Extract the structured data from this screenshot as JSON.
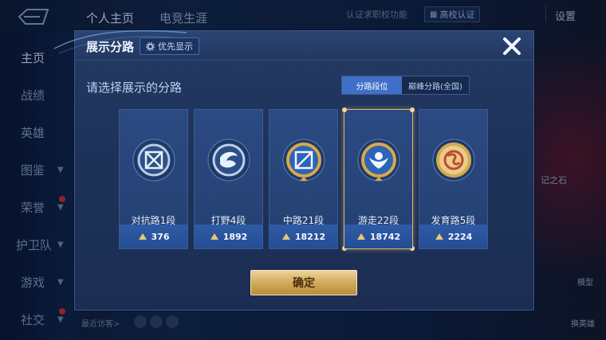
{
  "app": {
    "top_tabs": [
      "个人主页",
      "电竞生涯"
    ],
    "cert_link": "认证求职校功能",
    "cert_button": "高校认证",
    "settings": "设置",
    "nav": [
      {
        "label": "主页"
      },
      {
        "label": "战绩"
      },
      {
        "label": "英雄"
      },
      {
        "label": "图鉴"
      },
      {
        "label": "荣誉"
      },
      {
        "label": "护卫队"
      },
      {
        "label": "游戏"
      },
      {
        "label": "社交"
      }
    ],
    "recent_visitors": "最近访客>",
    "right_text": "记之石",
    "right_btn_model": "模型",
    "right_btn_swap": "换英雄"
  },
  "modal": {
    "title": "展示分路",
    "priority_button": "优先显示",
    "subtitle": "请选择展示的分路",
    "segments": {
      "active": "分路段位",
      "inactive": "巅峰分路(全国)"
    },
    "confirm": "确定",
    "cards": [
      {
        "label": "对抗路1段",
        "score": "376",
        "icon": "clash-lane-emblem",
        "emblem_color": "#b8cce6",
        "selected": false
      },
      {
        "label": "打野4段",
        "score": "1892",
        "icon": "jungle-emblem",
        "emblem_color": "#bcd0ea",
        "selected": false
      },
      {
        "label": "中路21段",
        "score": "18212",
        "icon": "mid-lane-emblem",
        "emblem_color": "#d6a94a",
        "selected": false
      },
      {
        "label": "游走22段",
        "score": "18742",
        "icon": "roam-emblem",
        "emblem_color": "#d6a94a",
        "selected": true
      },
      {
        "label": "发育路5段",
        "score": "2224",
        "icon": "farm-lane-emblem",
        "emblem_color": "#d6a94a",
        "selected": false
      }
    ]
  },
  "colors": {
    "accent_blue": "#3f6fc8",
    "gold": "#d2aa5c",
    "panel": "#1e3259"
  }
}
